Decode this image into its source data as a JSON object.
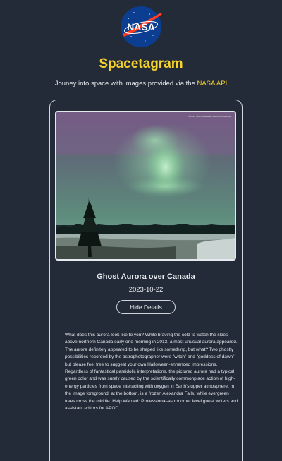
{
  "header": {
    "logo_text": "NASA",
    "logo_icon": "nasa-meatball-logo",
    "title": "Spacetagram",
    "subtitle_prefix": "Jouney into space with images provided via the ",
    "subtitle_link": "NASA API"
  },
  "post": {
    "image_credit": "© 2013 Yuichi Takasaka / www.blue-moon.ca",
    "title": "Ghost Aurora over Canada",
    "date": "2023-10-22",
    "toggle_label": "Hide Details",
    "description": "What does this aurora look like to you? While braving the cold to watch the skies above northern Canada early one morning in 2013, a most unusual aurora appeared. The aurora definitely appeared to be shaped like something, but what? Two ghostly possibilities recorded by the astrophotographer were \"witch\" and \"goddess of dawn\", but please feel free to suggest your own Halloween-enhanced impressions. Regardless of fantastical pareidolic interpretations, the pictured aurora had a typical green color and was surely caused by the scientifically commonplace action of high-energy particles from space interacting with oxygen in Earth's upper atmosphere. In the image foreground, at the bottom, is a frozen Alexandra Falls, while evergreen trees cross the middle. Help Wanted: Professional-astronomer level guest writers and assistant editors for APOD"
  },
  "colors": {
    "background": "#242b38",
    "accent": "#f5d32a",
    "nasa_blue": "#0b3d91",
    "nasa_red": "#fc3d21"
  }
}
